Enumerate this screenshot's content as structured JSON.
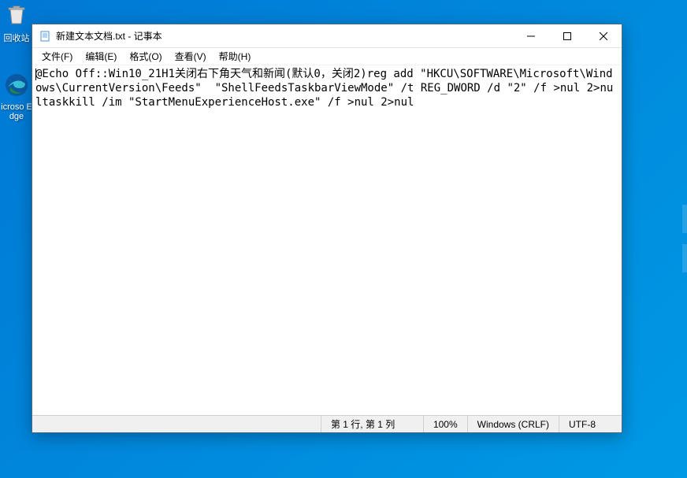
{
  "desktop": {
    "recycle_label": "回收站",
    "edge_label": "icroso Edge"
  },
  "window": {
    "title": "新建文本文档.txt - 记事本"
  },
  "menubar": {
    "file": "文件(F)",
    "edit": "编辑(E)",
    "format": "格式(O)",
    "view": "查看(V)",
    "help": "帮助(H)"
  },
  "editor": {
    "content": "@Echo Off::Win10_21H1关闭右下角天气和新闻(默认0，关闭2)reg add \"HKCU\\SOFTWARE\\Microsoft\\Windows\\CurrentVersion\\Feeds\"  \"ShellFeedsTaskbarViewMode\" /t REG_DWORD /d \"2\" /f >nul 2>nultaskkill /im \"StartMenuExperienceHost.exe\" /f >nul 2>nul"
  },
  "statusbar": {
    "position": "第 1 行, 第 1 列",
    "zoom": "100%",
    "eol": "Windows (CRLF)",
    "encoding": "UTF-8"
  }
}
